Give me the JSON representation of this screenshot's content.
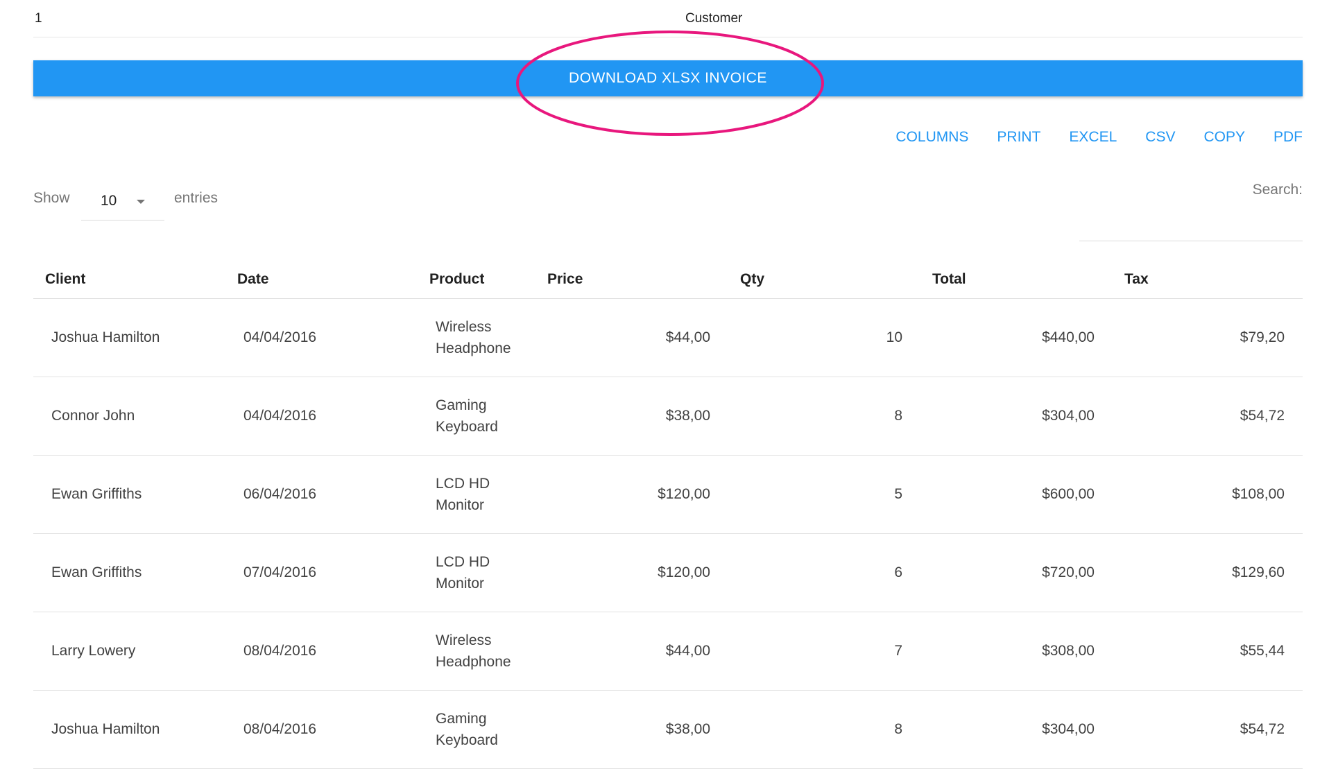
{
  "top_row": {
    "number": "1",
    "customer_label": "Customer"
  },
  "download_button": {
    "label": "DOWNLOAD XLSX INVOICE"
  },
  "export_buttons": [
    "COLUMNS",
    "PRINT",
    "EXCEL",
    "CSV",
    "COPY",
    "PDF"
  ],
  "length_control": {
    "show_label": "Show",
    "value": "10",
    "entries_label": "entries"
  },
  "search": {
    "label": "Search:",
    "value": ""
  },
  "table": {
    "headers": [
      "Client",
      "Date",
      "Product",
      "Price",
      "Qty",
      "Total",
      "Tax"
    ],
    "rows": [
      {
        "client": "Joshua Hamilton",
        "date": "04/04/2016",
        "product_line1": "Wireless",
        "product_line2": "Headphone",
        "price": "$44,00",
        "qty": "10",
        "total": "$440,00",
        "tax": "$79,20"
      },
      {
        "client": "Connor John",
        "date": "04/04/2016",
        "product_line1": "Gaming",
        "product_line2": "Keyboard",
        "price": "$38,00",
        "qty": "8",
        "total": "$304,00",
        "tax": "$54,72"
      },
      {
        "client": "Ewan Griffiths",
        "date": "06/04/2016",
        "product_line1": "LCD HD",
        "product_line2": "Monitor",
        "price": "$120,00",
        "qty": "5",
        "total": "$600,00",
        "tax": "$108,00"
      },
      {
        "client": "Ewan Griffiths",
        "date": "07/04/2016",
        "product_line1": "LCD HD",
        "product_line2": "Monitor",
        "price": "$120,00",
        "qty": "6",
        "total": "$720,00",
        "tax": "$129,60"
      },
      {
        "client": "Larry Lowery",
        "date": "08/04/2016",
        "product_line1": "Wireless",
        "product_line2": "Headphone",
        "price": "$44,00",
        "qty": "7",
        "total": "$308,00",
        "tax": "$55,44"
      },
      {
        "client": "Joshua Hamilton",
        "date": "08/04/2016",
        "product_line1": "Gaming",
        "product_line2": "Keyboard",
        "price": "$38,00",
        "qty": "8",
        "total": "$304,00",
        "tax": "$54,72"
      }
    ]
  },
  "colors": {
    "primary": "#2196f3",
    "highlight": "#e8177d"
  }
}
